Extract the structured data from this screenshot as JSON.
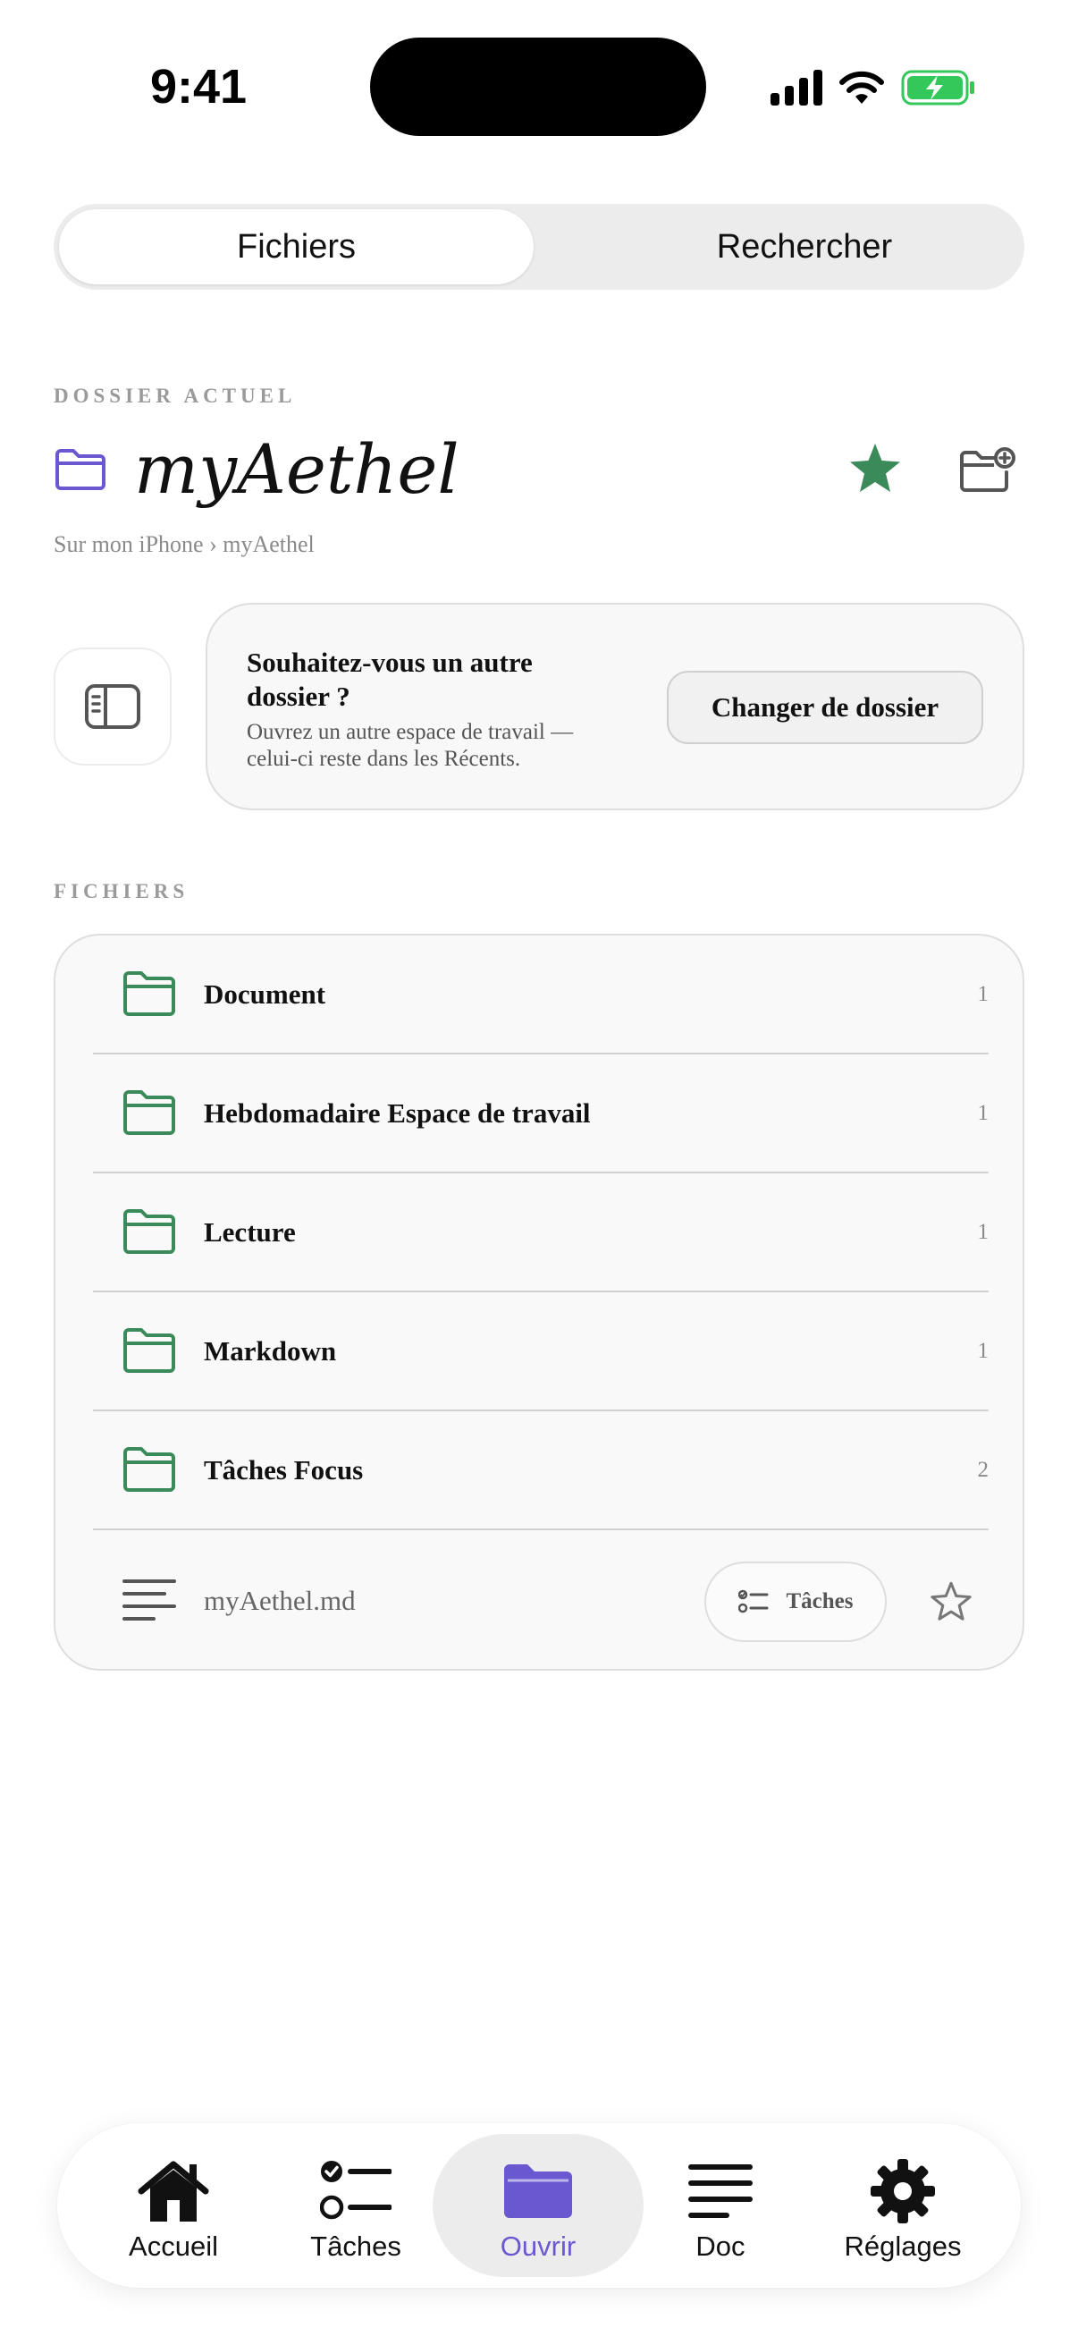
{
  "status_bar": {
    "time": "9:41"
  },
  "segmented": {
    "files": "Fichiers",
    "search": "Rechercher"
  },
  "current_folder": {
    "section_label": "DOSSIER ACTUEL",
    "title": "myAethel",
    "breadcrumb": "Sur mon iPhone › myAethel"
  },
  "change_folder": {
    "title": "Souhaitez-vous un autre dossier ?",
    "subtitle": "Ouvrez un autre espace de travail — celui-ci reste dans les Récents.",
    "button": "Changer de dossier"
  },
  "files": {
    "section_label": "FICHIERS",
    "folders": [
      {
        "name": "Document",
        "count": "1"
      },
      {
        "name": "Hebdomadaire Espace de travail",
        "count": "1"
      },
      {
        "name": "Lecture",
        "count": "1"
      },
      {
        "name": "Markdown",
        "count": "1"
      },
      {
        "name": "Tâches Focus",
        "count": "2"
      }
    ],
    "markdown_file": {
      "name": "myAethel.md",
      "tasks_chip": "Tâches"
    }
  },
  "tabbar": {
    "items": [
      {
        "label": "Accueil",
        "icon": "house-icon"
      },
      {
        "label": "Tâches",
        "icon": "checklist-icon"
      },
      {
        "label": "Ouvrir",
        "icon": "folder-icon"
      },
      {
        "label": "Doc",
        "icon": "text-lines-icon"
      },
      {
        "label": "Réglages",
        "icon": "gear-icon"
      }
    ],
    "active": "Ouvrir"
  },
  "colors": {
    "accent_purple": "#6a58d0",
    "folder_green": "#3a8a5a",
    "star_green": "#3a8a5a",
    "battery_green": "#34c759"
  }
}
